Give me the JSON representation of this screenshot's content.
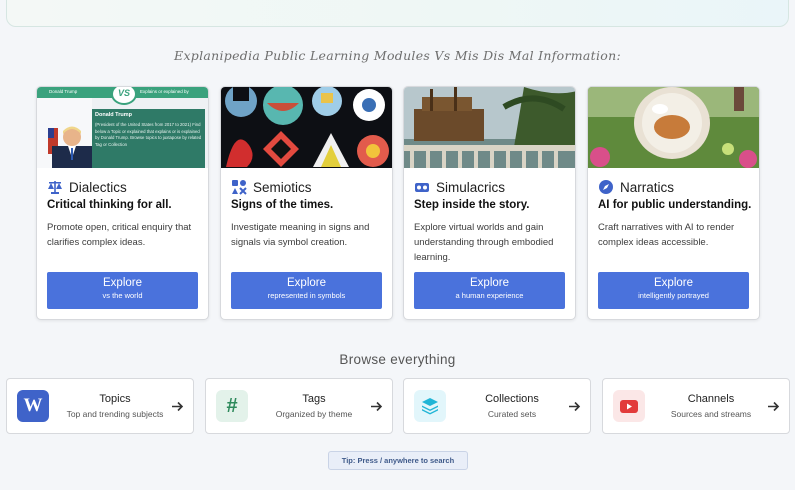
{
  "modules_heading": "Explanipedia Public Learning Modules Vs Mis Dis Mal Information:",
  "cards": [
    {
      "title": "Dialectics",
      "tagline": "Critical thinking for all.",
      "description": "Promote open, critical enquiry that clarifies complex ideas.",
      "button_label": "Explore",
      "button_sub": "vs the world",
      "icon": "scales-icon",
      "image": {
        "vs_badge": "VS",
        "left_header": "Donald Trump",
        "right_header": "Explains or explained by",
        "panel_title": "Donald Trump",
        "panel_text": "(President of the United States from 2017 to 2021) Find below a Topic or explained that explains or is explained by Donald Trump. Browse topics to juxtapose by related Tag or Collection"
      }
    },
    {
      "title": "Semiotics",
      "tagline": "Signs of the times.",
      "description": "Investigate meaning in signs and signals via symbol creation.",
      "button_label": "Explore",
      "button_sub": "represented in symbols",
      "icon": "shapes-icon"
    },
    {
      "title": "Simulacrics",
      "tagline": "Step inside the story.",
      "description": "Explore virtual worlds and gain understanding through embodied learning.",
      "button_label": "Explore",
      "button_sub": "a human experience",
      "icon": "vr-headset-icon"
    },
    {
      "title": "Narratics",
      "tagline": "AI for public understanding.",
      "description": "Craft narratives with AI to render complex ideas accessible.",
      "button_label": "Explore",
      "button_sub": "intelligently portrayed",
      "icon": "compass-icon"
    }
  ],
  "browse_heading": "Browse everything",
  "browse": [
    {
      "title": "Topics",
      "subtitle": "Top and trending subjects",
      "icon": "wikipedia-w-icon",
      "color": "#3f63c9"
    },
    {
      "title": "Tags",
      "subtitle": "Organized by theme",
      "icon": "hashtag-icon",
      "color": "#2e8a5c"
    },
    {
      "title": "Collections",
      "subtitle": "Curated sets",
      "icon": "layers-icon",
      "color": "#20b5d6"
    },
    {
      "title": "Channels",
      "subtitle": "Sources and streams",
      "icon": "youtube-icon",
      "color": "#e23b3b"
    }
  ],
  "tip": "Tip: Press / anywhere to search",
  "colors": {
    "accent": "#4a72dc",
    "background": "#f4f6f9"
  }
}
